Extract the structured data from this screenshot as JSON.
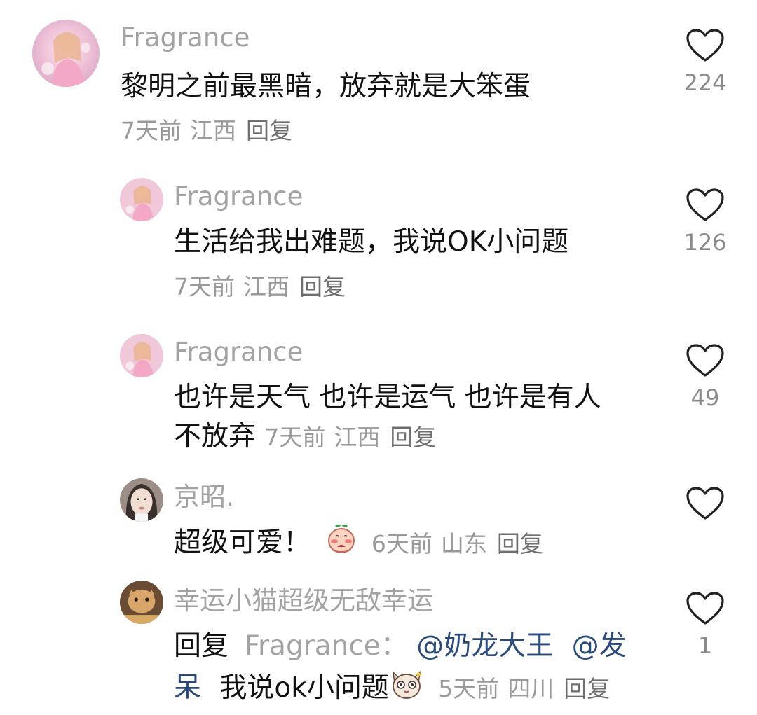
{
  "comments": [
    {
      "username": "Fragrance",
      "text": "黎明之前最黑暗，放弃就是大笨蛋",
      "time": "7天前",
      "location": "江西",
      "reply_label": "回复",
      "likes": "224"
    },
    {
      "username": "Fragrance",
      "text": "生活给我出难题，我说OK小问题",
      "time": "7天前",
      "location": "江西",
      "reply_label": "回复",
      "likes": "126"
    },
    {
      "username": "Fragrance",
      "text_line1": "也许是天气 也许是运气 也许是有人",
      "text_line2": "不放弃",
      "time": "7天前",
      "location": "江西",
      "reply_label": "回复",
      "likes": "49"
    },
    {
      "username": "京昭.",
      "text": "超级可爱！",
      "emoji": "blushing-peach-emoji",
      "time": "6天前",
      "location": "山东",
      "reply_label": "回复",
      "likes": ""
    },
    {
      "username": "幸运小猫超级无敌幸运",
      "reply_prefix": "回复",
      "reply_to": "Fragrance：",
      "mention1": "@奶龙大王",
      "mention2_part1": "@发",
      "mention2_part2": "呆",
      "text": "我说ok小问题",
      "emoji": "cat-face-emoji",
      "time": "5天前",
      "location": "四川",
      "reply_label": "回复",
      "likes": "1"
    }
  ],
  "colors": {
    "username": "#a3a3a3",
    "text": "#111111",
    "meta": "#9a9a9a",
    "mention": "#2a4a7a",
    "heart_stroke": "#222222"
  },
  "icons": {
    "like": "heart-outline-icon"
  }
}
